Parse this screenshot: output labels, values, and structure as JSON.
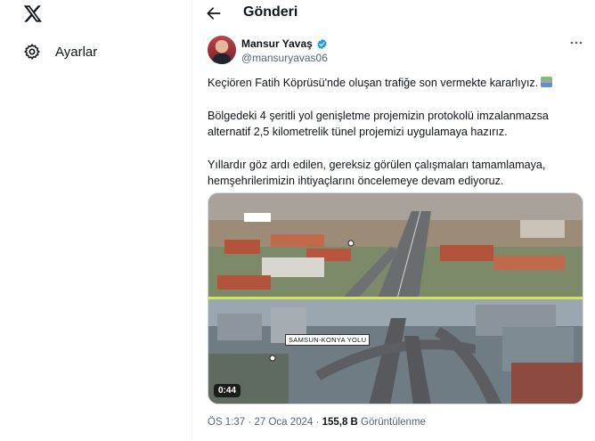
{
  "nav": {
    "logo_icon": "x-logo-icon",
    "settings_icon": "gear-icon",
    "settings_label": "Ayarlar"
  },
  "header": {
    "back_icon": "arrow-left-icon",
    "title": "Gönderi"
  },
  "tweet": {
    "author_name": "Mansur Yavaş",
    "author_handle": "@mansuryavas06",
    "verified": true,
    "lines": [
      "Keçiören Fatih Köprüsü'nde oluşan trafiğe son vermekte kararlıyız.",
      "Bölgedeki 4 şeritli yol genişletme projemizin protokolü imzalanmazsa",
      "alternatif 2,5 kilometrelik tünel projemizi uygulamaya hazırız.",
      "Yıllardır göz ardı edilen, gereksiz görülen çalışmaları tamamlamaya,",
      "hemşehrilerimizin ihtiyaçlarını öncelemeye devam ediyoruz."
    ],
    "media": {
      "duration": "0:44",
      "sign_text": "SAMSUN-KONYA YOLU"
    },
    "time": "ÖS 1:37",
    "separator": "·",
    "date": "27 Oca 2024",
    "views_count": "155,8 B",
    "views_label": "Görüntülenme"
  },
  "colors": {
    "text": "#0f1419",
    "secondary": "#536471",
    "verified_blue": "#1d9bf0",
    "border": "#cfd9de"
  }
}
